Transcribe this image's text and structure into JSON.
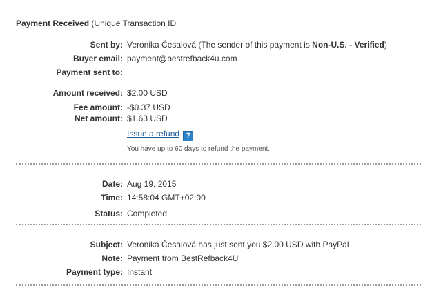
{
  "header": {
    "title": "Payment Received",
    "subtitle": "(Unique Transaction ID"
  },
  "details": {
    "sent_by": {
      "label": "Sent by:",
      "name": "Veronika Česalová",
      "prefix": "(The sender of this payment is",
      "status": "Non-U.S. - Verified",
      "suffix": ")"
    },
    "buyer_email": {
      "label": "Buyer email:",
      "value": "payment@bestrefback4u.com"
    },
    "payment_sent_to": {
      "label": "Payment sent to:",
      "value": ""
    },
    "amount_received": {
      "label": "Amount received:",
      "value": "$2.00 USD"
    },
    "fee_amount": {
      "label": "Fee amount:",
      "value": "-$0.37 USD"
    },
    "net_amount": {
      "label": "Net amount:",
      "value": "$1.63 USD"
    },
    "refund": {
      "link_label": "Issue a refund",
      "help_glyph": "?",
      "note": "You have up to 60 days to refund the payment."
    }
  },
  "timing": {
    "date": {
      "label": "Date:",
      "value": "Aug 19, 2015"
    },
    "time": {
      "label": "Time:",
      "value": "14:58:04 GMT+02:00"
    },
    "status": {
      "label": "Status:",
      "value": "Completed"
    }
  },
  "message": {
    "subject": {
      "label": "Subject:",
      "value": "Veronika Česalová has just sent you $2.00 USD with PayPal"
    },
    "note": {
      "label": "Note:",
      "value": "Payment from BestRefback4U"
    },
    "payment_type": {
      "label": "Payment type:",
      "value": "Instant"
    }
  },
  "colors": {
    "link": "#1d5c99",
    "help_icon": "#2e83c8",
    "divider": "#9a9a9a"
  },
  "icons": {
    "help": "question-mark-icon"
  }
}
